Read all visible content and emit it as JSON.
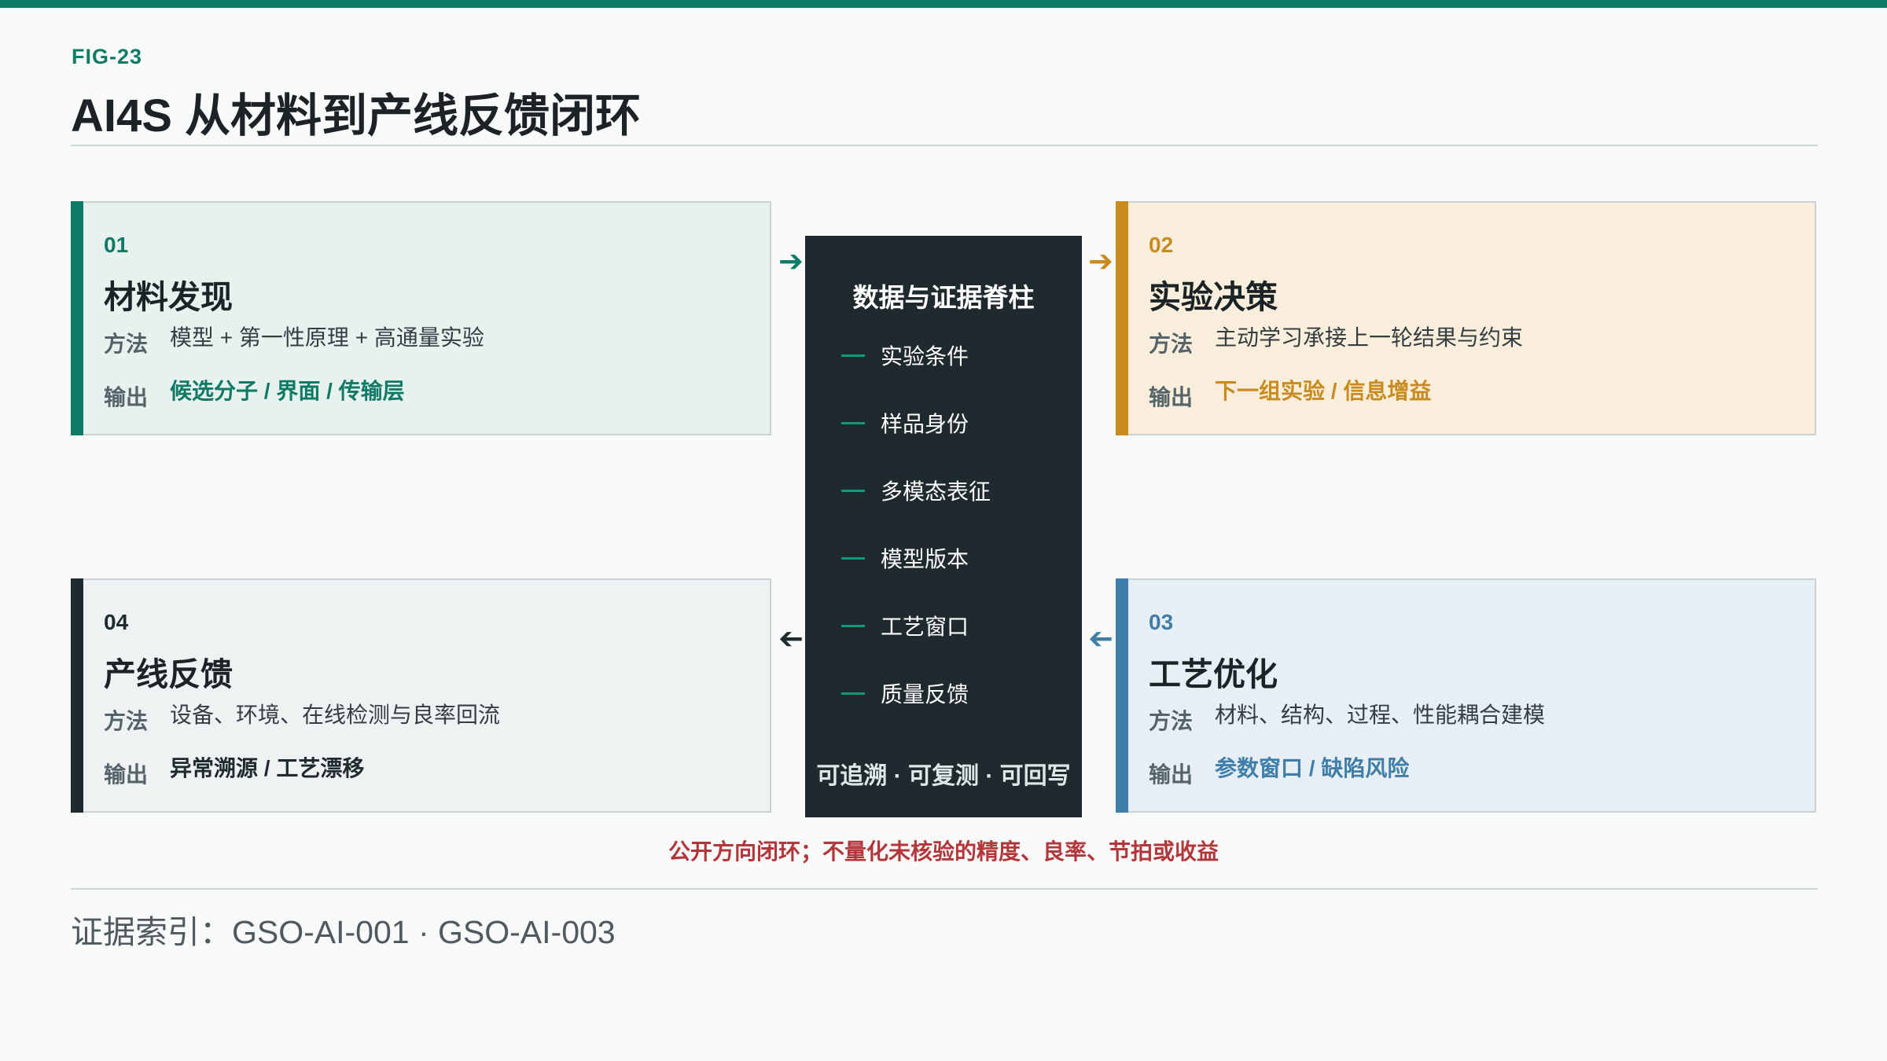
{
  "header": {
    "fig_label": "FIG-23",
    "title": "AI4S 从材料到产线反馈闭环"
  },
  "labels": {
    "method": "方法",
    "output": "输出"
  },
  "cards": [
    {
      "num": "01",
      "name": "材料发现",
      "method": "模型 + 第一性原理 + 高通量实验",
      "output": "候选分子 / 界面 / 传输层",
      "color": "#0f7a65"
    },
    {
      "num": "02",
      "name": "实验决策",
      "method": "主动学习承接上一轮结果与约束",
      "output": "下一组实验 / 信息增益",
      "color": "#c98a1e"
    },
    {
      "num": "03",
      "name": "工艺优化",
      "method": "材料、结构、过程、性能耦合建模",
      "output": "参数窗口 / 缺陷风险",
      "color": "#3f7ea8"
    },
    {
      "num": "04",
      "name": "产线反馈",
      "method": "设备、环境、在线检测与良率回流",
      "output": "异常溯源 / 工艺漂移",
      "color": "#1f2a2e"
    }
  ],
  "spine": {
    "title": "数据与证据脊柱",
    "items": [
      "实验条件",
      "样品身份",
      "多模态表征",
      "模型版本",
      "工艺窗口",
      "质量反馈"
    ],
    "footer": "可追溯 · 可复测 · 可回写"
  },
  "arrows": {
    "glyph": "➔",
    "icons": [
      "arrow-right-icon",
      "arrow-right-icon",
      "arrow-left-icon",
      "arrow-left-icon"
    ]
  },
  "note": "公开方向闭环；不量化未核验的精度、良率、节拍或收益",
  "evidence": "证据索引：GSO-AI-001 · GSO-AI-003"
}
